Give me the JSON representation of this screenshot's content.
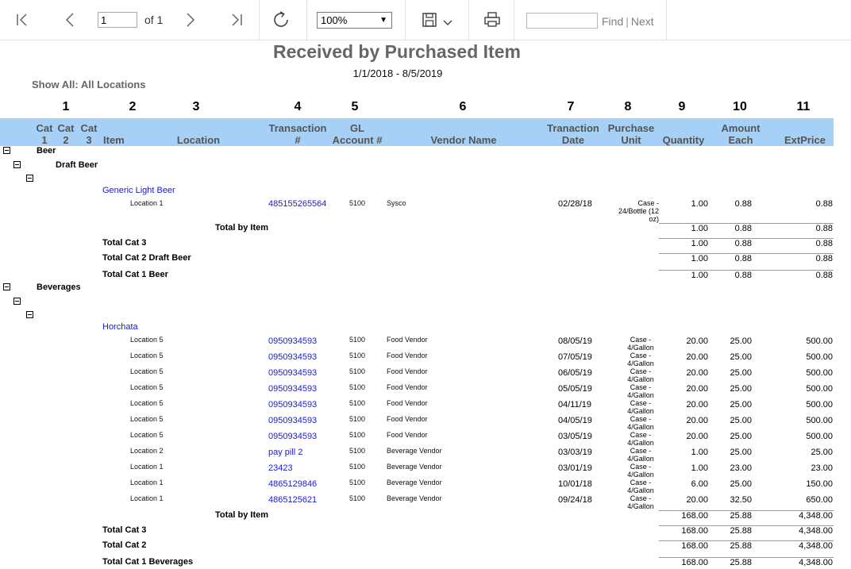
{
  "toolbar": {
    "page": "1",
    "of_label": "of 1",
    "zoom": "100%",
    "find_label": "Find",
    "find_separator": "|",
    "next_label": "Next",
    "icons": [
      "first-page-icon",
      "prev-page-icon",
      "next-page-icon",
      "last-page-icon",
      "refresh-icon",
      "save-icon",
      "chevron-down-icon",
      "print-icon"
    ]
  },
  "report": {
    "title": "Received by Purchased Item",
    "date_range": "1/1/2018 - 8/5/2019",
    "show_all": "Show All: All Locations",
    "column_numbers": [
      "1",
      "2",
      "3",
      "4",
      "5",
      "6",
      "7",
      "8",
      "9",
      "10",
      "11"
    ],
    "header": {
      "cat1a": "Cat",
      "cat1b": "1",
      "cat2a": "Cat",
      "cat2b": "2",
      "cat3a": "Cat",
      "cat3b": "3",
      "item": "Item",
      "location": "Location",
      "txn_a": "Transaction",
      "txn_b": "#",
      "gl_a": "GL",
      "gl_b": "Account #",
      "vendor": "Vendor Name",
      "tdate_a": "Tranaction",
      "tdate_b": "Date",
      "unit_a": "Purchase",
      "unit_b": "Unit",
      "qty": "Quantity",
      "amt_a": "Amount",
      "amt_b": "Each",
      "ext": "ExtPrice"
    },
    "header_color": "#a6d0f5",
    "link_color": "#1a1acc",
    "beer": {
      "cat1": "Beer",
      "cat2": "Draft Beer",
      "item": "Generic Light Beer",
      "row": {
        "location": "Location 1",
        "txn": "485155265564",
        "gl": "5100",
        "vendor": "Sysco",
        "date": "02/28/18",
        "unit1": "Case -",
        "unit2": "24/Bottle (12",
        "unit3": "oz)",
        "qty": "1.00",
        "amt": "0.88",
        "ext": "0.88"
      },
      "total_item_label": "Total by Item",
      "total_item": {
        "qty": "1.00",
        "amt": "0.88",
        "ext": "0.88"
      },
      "total_cat3_label": "Total Cat 3",
      "total_cat3": {
        "qty": "1.00",
        "amt": "0.88",
        "ext": "0.88"
      },
      "total_cat2_label": "Total Cat 2 Draft Beer",
      "total_cat2": {
        "qty": "1.00",
        "amt": "0.88",
        "ext": "0.88"
      },
      "total_cat1_label": "Total Cat 1 Beer",
      "total_cat1": {
        "qty": "1.00",
        "amt": "0.88",
        "ext": "0.88"
      }
    },
    "bev": {
      "cat1": "Beverages",
      "item": "Horchata",
      "rows": [
        {
          "location": "Location 5",
          "txn": "0950934593",
          "gl": "5100",
          "vendor": "Food Vendor",
          "date": "08/05/19",
          "unit1": "Case -",
          "unit2": "4/Gallon",
          "qty": "20.00",
          "amt": "25.00",
          "ext": "500.00"
        },
        {
          "location": "Location 5",
          "txn": "0950934593",
          "gl": "5100",
          "vendor": "Food Vendor",
          "date": "07/05/19",
          "unit1": "Case -",
          "unit2": "4/Gallon",
          "qty": "20.00",
          "amt": "25.00",
          "ext": "500.00"
        },
        {
          "location": "Location 5",
          "txn": "0950934593",
          "gl": "5100",
          "vendor": "Food Vendor",
          "date": "06/05/19",
          "unit1": "Case -",
          "unit2": "4/Gallon",
          "qty": "20.00",
          "amt": "25.00",
          "ext": "500.00"
        },
        {
          "location": "Location 5",
          "txn": "0950934593",
          "gl": "5100",
          "vendor": "Food Vendor",
          "date": "05/05/19",
          "unit1": "Case -",
          "unit2": "4/Gallon",
          "qty": "20.00",
          "amt": "25.00",
          "ext": "500.00"
        },
        {
          "location": "Location 5",
          "txn": "0950934593",
          "gl": "5100",
          "vendor": "Food Vendor",
          "date": "04/11/19",
          "unit1": "Case -",
          "unit2": "4/Gallon",
          "qty": "20.00",
          "amt": "25.00",
          "ext": "500.00"
        },
        {
          "location": "Location 5",
          "txn": "0950934593",
          "gl": "5100",
          "vendor": "Food Vendor",
          "date": "04/05/19",
          "unit1": "Case -",
          "unit2": "4/Gallon",
          "qty": "20.00",
          "amt": "25.00",
          "ext": "500.00"
        },
        {
          "location": "Location 5",
          "txn": "0950934593",
          "gl": "5100",
          "vendor": "Food Vendor",
          "date": "03/05/19",
          "unit1": "Case -",
          "unit2": "4/Gallon",
          "qty": "20.00",
          "amt": "25.00",
          "ext": "500.00"
        },
        {
          "location": "Location 2",
          "txn": "pay pill  2",
          "gl": "5100",
          "vendor": "Beverage Vendor",
          "date": "03/03/19",
          "unit1": "Case -",
          "unit2": "4/Gallon",
          "qty": "1.00",
          "amt": "25.00",
          "ext": "25.00"
        },
        {
          "location": "Location 1",
          "txn": "23423",
          "gl": "5100",
          "vendor": "Beverage Vendor",
          "date": "03/01/19",
          "unit1": "Case -",
          "unit2": "4/Gallon",
          "qty": "1.00",
          "amt": "23.00",
          "ext": "23.00"
        },
        {
          "location": "Location 1",
          "txn": "4865129846",
          "gl": "5100",
          "vendor": "Beverage Vendor",
          "date": "10/01/18",
          "unit1": "Case -",
          "unit2": "4/Gallon",
          "qty": "6.00",
          "amt": "25.00",
          "ext": "150.00"
        },
        {
          "location": "Location 1",
          "txn": "4865125621",
          "gl": "5100",
          "vendor": "Beverage Vendor",
          "date": "09/24/18",
          "unit1": "Case -",
          "unit2": "4/Gallon",
          "qty": "20.00",
          "amt": "32.50",
          "ext": "650.00"
        }
      ],
      "total_item_label": "Total by Item",
      "total_item": {
        "qty": "168.00",
        "amt": "25.88",
        "ext": "4,348.00"
      },
      "total_cat3_label": "Total Cat 3",
      "total_cat3": {
        "qty": "168.00",
        "amt": "25.88",
        "ext": "4,348.00"
      },
      "total_cat2_label": "Total Cat 2",
      "total_cat2": {
        "qty": "168.00",
        "amt": "25.88",
        "ext": "4,348.00"
      },
      "total_cat1_label": "Total Cat 1 Beverages",
      "total_cat1": {
        "qty": "168.00",
        "amt": "25.88",
        "ext": "4,348.00"
      }
    }
  }
}
